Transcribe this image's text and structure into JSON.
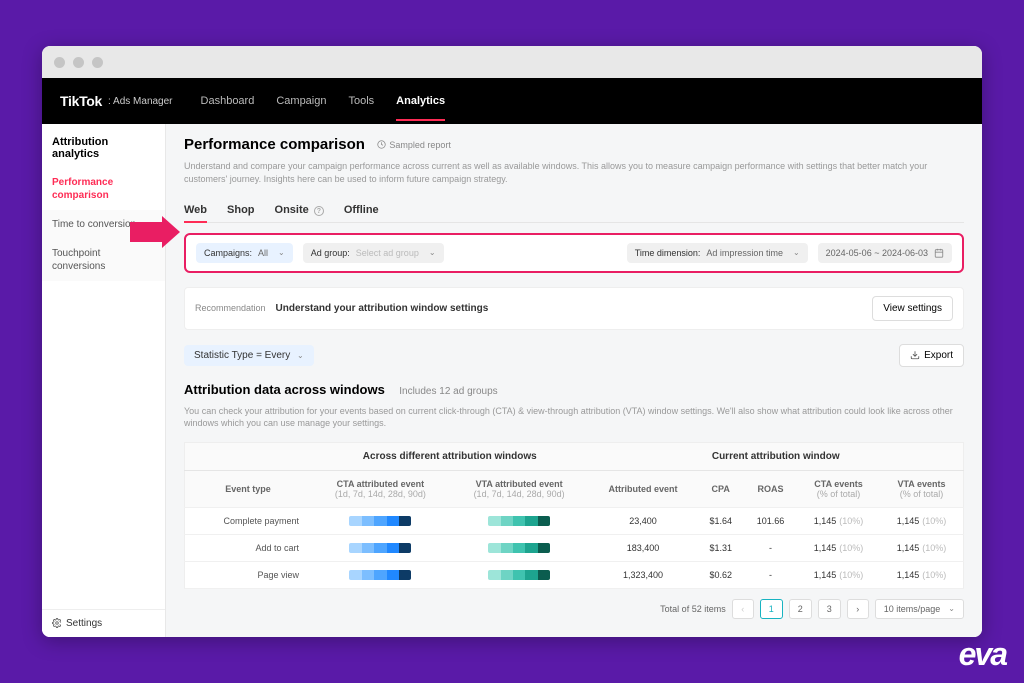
{
  "brand": {
    "name": "TikTok",
    "sub": ": Ads Manager"
  },
  "nav": [
    "Dashboard",
    "Campaign",
    "Tools",
    "Analytics"
  ],
  "nav_active": 3,
  "sidebar": {
    "title": "Attribution analytics",
    "items": [
      "Performance comparison",
      "Time to conversion",
      "Touchpoint conversions"
    ],
    "active": 0,
    "settings": "Settings"
  },
  "page": {
    "title": "Performance comparison",
    "sampled": "Sampled report",
    "description": "Understand and compare your campaign performance across current as well as available windows. This allows you to measure campaign performance with settings that better match your customers' journey. Insights here can be used to inform future campaign strategy."
  },
  "subtabs": [
    "Web",
    "Shop",
    "Onsite",
    "Offline"
  ],
  "subtabs_active": 0,
  "filters": {
    "campaigns_label": "Campaigns:",
    "campaigns_value": "All",
    "adgroup_label": "Ad group:",
    "adgroup_placeholder": "Select ad group",
    "timedim_label": "Time dimension:",
    "timedim_value": "Ad impression time",
    "date_range": "2024-05-06 ~ 2024-06-03"
  },
  "recommendation": {
    "label": "Recommendation",
    "text": "Understand your attribution window settings",
    "button": "View settings"
  },
  "stat_type": "Statistic Type = Every",
  "export": "Export",
  "section": {
    "title": "Attribution data across windows",
    "subtitle": "Includes 12 ad groups",
    "description": "You can check your attribution for your events based on current click-through (CTA) & view-through attribution (VTA) window settings. We'll also show what attribution could look like across other windows which you can use manage your settings."
  },
  "table": {
    "group1": "Across different attribution windows",
    "group2": "Current attribution window",
    "headers": {
      "event": "Event type",
      "cta_windows": "CTA attributed event",
      "cta_windows_sub": "(1d, 7d, 14d, 28d, 90d)",
      "vta_windows": "VTA attributed event",
      "vta_windows_sub": "(1d, 7d, 14d, 28d, 90d)",
      "attributed": "Attributed event",
      "cpa": "CPA",
      "roas": "ROAS",
      "cta_events": "CTA events",
      "cta_events_sub": "(% of total)",
      "vta_events": "VTA events",
      "vta_events_sub": "(% of total)"
    },
    "rows": [
      {
        "event": "Complete payment",
        "attributed": "23,400",
        "cpa": "$1.64",
        "roas": "101.66",
        "cta": "1,145",
        "cta_pct": "(10%)",
        "vta": "1,145",
        "vta_pct": "(10%)"
      },
      {
        "event": "Add to cart",
        "attributed": "183,400",
        "cpa": "$1.31",
        "roas": "-",
        "cta": "1,145",
        "cta_pct": "(10%)",
        "vta": "1,145",
        "vta_pct": "(10%)"
      },
      {
        "event": "Page view",
        "attributed": "1,323,400",
        "cpa": "$0.62",
        "roas": "-",
        "cta": "1,145",
        "cta_pct": "(10%)",
        "vta": "1,145",
        "vta_pct": "(10%)"
      }
    ]
  },
  "pagination": {
    "total_label": "Total of 52 items",
    "pages": [
      "1",
      "2",
      "3"
    ],
    "per_page": "10 items/page"
  },
  "watermark": "eva"
}
